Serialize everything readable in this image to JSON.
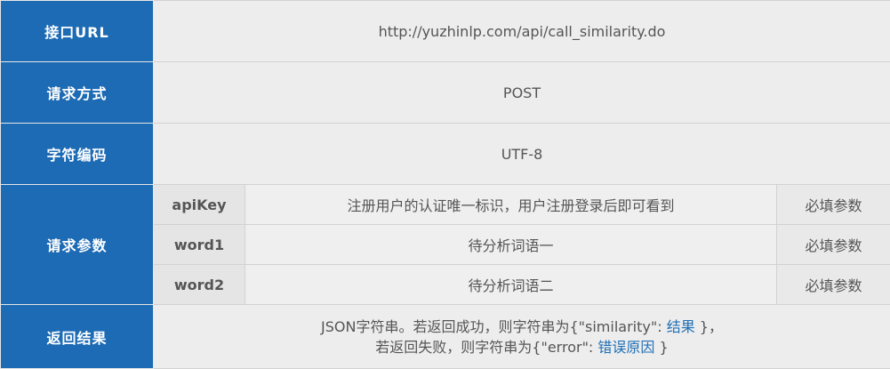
{
  "api_table": {
    "url": {
      "label": "接口URL",
      "value": "http://yuzhinlp.com/api/call_similarity.do"
    },
    "method": {
      "label": "请求方式",
      "value": "POST"
    },
    "encoding": {
      "label": "字符编码",
      "value": "UTF-8"
    },
    "params": {
      "label": "请求参数",
      "rows": [
        {
          "name": "apiKey",
          "desc": "注册用户的认证唯一标识，用户注册登录后即可看到",
          "required": "必填参数"
        },
        {
          "name": "word1",
          "desc": "待分析词语一",
          "required": "必填参数"
        },
        {
          "name": "word2",
          "desc": "待分析词语二",
          "required": "必填参数"
        }
      ]
    },
    "result": {
      "label": "返回结果",
      "line1_prefix": "JSON字符串。若返回成功，则字符串为{\"similarity\": ",
      "line1_link": "结果",
      "line1_suffix": " }，",
      "line2_prefix": "若返回失败，则字符串为{\"error\": ",
      "line2_link": "错误原因",
      "line2_suffix": " }"
    }
  },
  "colors": {
    "label_bg": "#1d6bb4",
    "link": "#1f6fb5",
    "cell_bg": "#ededed"
  }
}
